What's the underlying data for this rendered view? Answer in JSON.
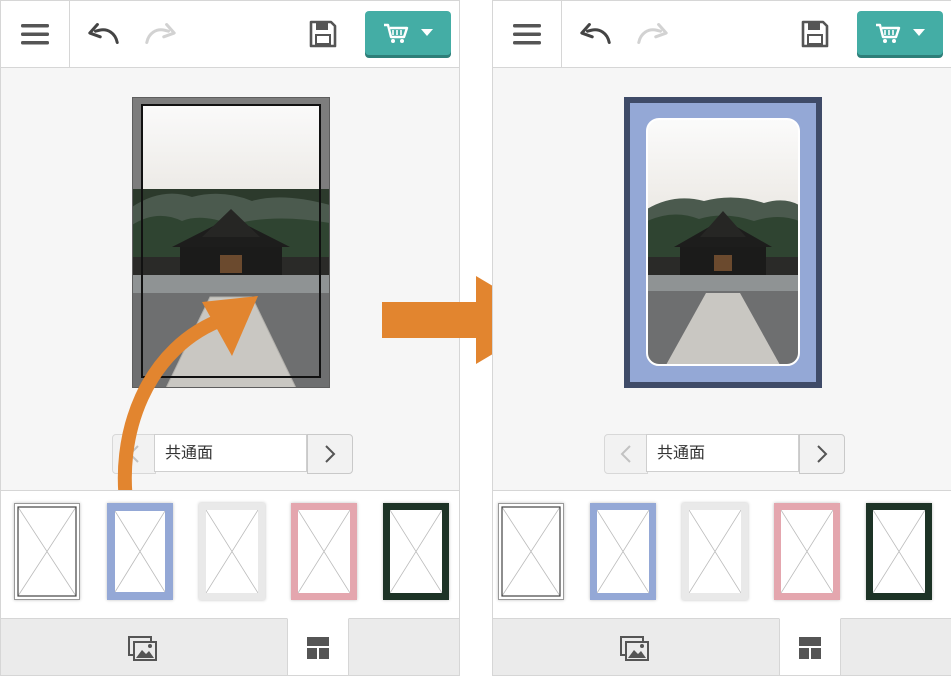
{
  "colors": {
    "accent": "#44ada5",
    "arrow": "#e2852f",
    "frame_blue_outer": "#3f4b68",
    "frame_blue_inner": "#94a8d6",
    "frame_gray": "#7a7a7a",
    "thumb_pink": "#e4a6ae",
    "thumb_green": "#1d3326"
  },
  "icons": {
    "menu": "hamburger-icon",
    "undo": "undo-icon",
    "redo": "redo-icon",
    "save": "save-icon",
    "cart": "cart-icon",
    "dropdown": "caret-down-icon",
    "prev": "chevron-left-icon",
    "next": "chevron-right-icon",
    "photo_tab": "photos-icon",
    "frame_tab": "layout-icon"
  },
  "before": {
    "page_selector": {
      "label": "共通面"
    },
    "frames": [
      "none",
      "blue",
      "white",
      "pink",
      "dark-green"
    ]
  },
  "after": {
    "page_selector": {
      "label": "共通面"
    },
    "frames": [
      "none",
      "blue",
      "white",
      "pink",
      "dark-green"
    ]
  }
}
